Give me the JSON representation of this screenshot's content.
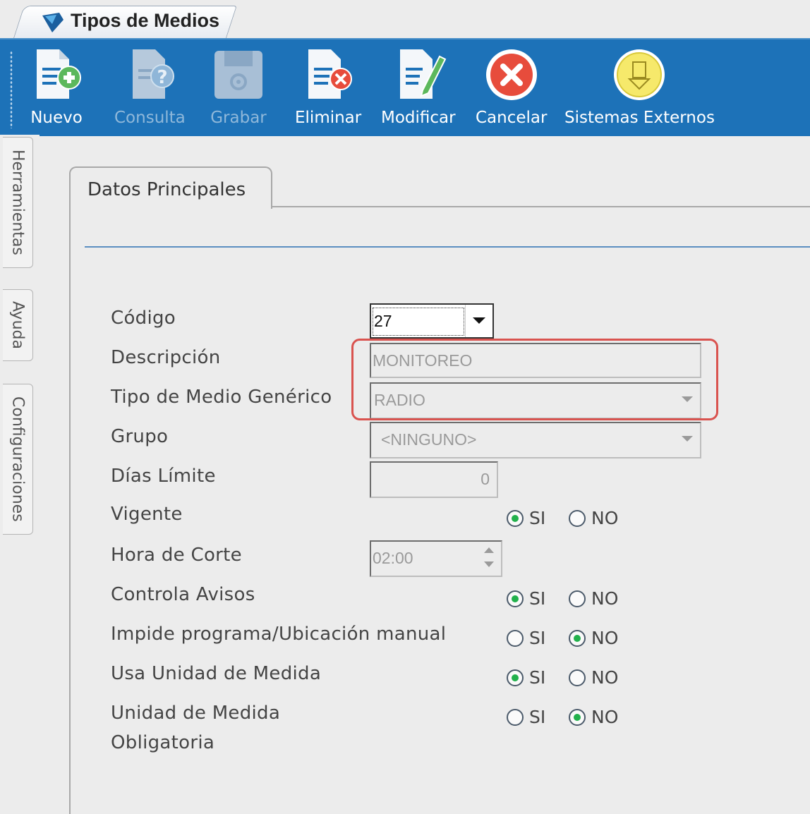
{
  "window": {
    "title": "Tipos de Medios"
  },
  "toolbar": {
    "nuevo": "Nuevo",
    "consulta": "Consulta",
    "grabar": "Grabar",
    "eliminar": "Eliminar",
    "modificar": "Modificar",
    "cancelar": "Cancelar",
    "sistemas_externos": "Sistemas Externos",
    "disabled": [
      "Consulta",
      "Grabar"
    ]
  },
  "side_tabs": {
    "herramientas": "Herramientas",
    "ayuda": "Ayuda",
    "configuraciones": "Configuraciones"
  },
  "panel_tab": "Datos Principales",
  "form": {
    "codigo": {
      "label": "Código",
      "value": "27"
    },
    "descripcion": {
      "label": "Descripción",
      "value": "MONITOREO"
    },
    "tipo_medio": {
      "label": "Tipo de Medio Genérico",
      "value": "RADIO"
    },
    "grupo": {
      "label": "Grupo",
      "value": "<NINGUNO>"
    },
    "dias_limite": {
      "label": "Días Límite",
      "value": "0"
    },
    "vigente": {
      "label": "Vigente",
      "selected": "SI"
    },
    "hora_corte": {
      "label": "Hora de Corte",
      "value": "02:00"
    },
    "controla_avisos": {
      "label": "Controla Avisos",
      "selected": "SI"
    },
    "impide_programa": {
      "label": "Impide programa/Ubicación manual",
      "selected": "NO"
    },
    "usa_unidad": {
      "label": "Usa Unidad de Medida",
      "selected": "SI"
    },
    "unidad_obligatoria": {
      "label_line1": "Unidad de Medida",
      "label_line2": "Obligatoria",
      "selected": "NO"
    },
    "opt_si": "SI",
    "opt_no": "NO"
  },
  "colors": {
    "toolbar": "#1d72b8",
    "highlight": "#d9534f",
    "radio_on": "#22b14c",
    "separator": "#5b8fc1"
  }
}
